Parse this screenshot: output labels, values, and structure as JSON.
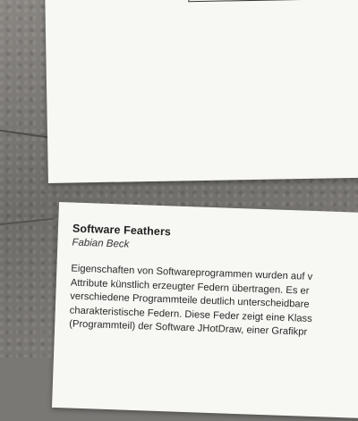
{
  "card": {
    "title": "Software Feathers",
    "author": "Fabian Beck",
    "lines": [
      "Eigenschaften von Softwareprogrammen wurden auf v",
      "Attribute künstlich erzeugter Federn übertragen. Es er",
      "verschiedene Programmteile deutlich unterscheidbare",
      "charakteristische Federn. Diese Feder zeigt eine Klass",
      "(Programmteil) der Software JHotDraw, einer Grafikpr"
    ]
  }
}
